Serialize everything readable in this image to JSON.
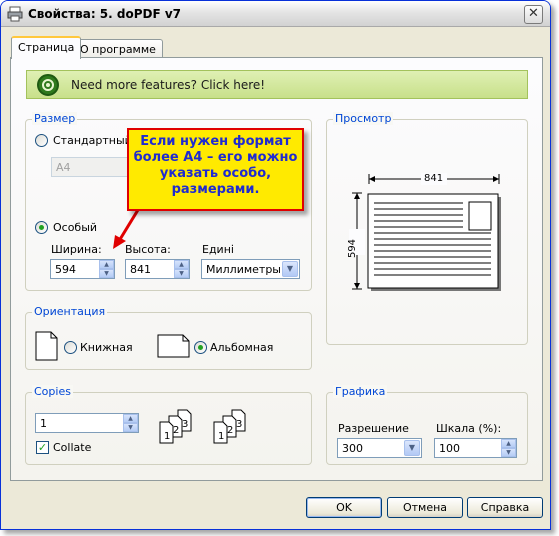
{
  "window": {
    "title": "Свойства: 5. doPDF v7",
    "close_glyph": "✕"
  },
  "tabs": [
    {
      "label": "Страница",
      "active": true
    },
    {
      "label": "О программе",
      "active": false
    }
  ],
  "banner": {
    "text": "Need more features? Click here!"
  },
  "size_group": {
    "label": "Размер",
    "standard_label": "Стандартный",
    "standard_value": "A4",
    "custom_label": "Особый",
    "width_label": "Ширина:",
    "width_value": "594",
    "height_label": "Высота:",
    "height_value": "841",
    "units_label": "Едині",
    "units_value": "Миллиметры",
    "selected": "custom"
  },
  "callout": {
    "lines": [
      "Если нужен формат",
      "более A4 – его можно",
      "указать особо,",
      "размерами."
    ],
    "colors": {
      "fill": "#ffea00",
      "border": "#e00000",
      "text": "#1f2bd1"
    }
  },
  "preview_group": {
    "label": "Просмотр",
    "width_dim": "841",
    "height_dim": "594"
  },
  "orientation_group": {
    "label": "Ориентация",
    "portrait_label": "Книжная",
    "landscape_label": "Альбомная",
    "selected": "landscape"
  },
  "copies_group": {
    "label": "Copies",
    "copies_value": "1",
    "collate_label": "Collate",
    "collate_checked": true,
    "collate_page_numbers": [
      "1",
      "2",
      "3"
    ]
  },
  "graphics_group": {
    "label": "Графика",
    "resolution_label": "Разрешение",
    "resolution_value": "300",
    "scale_label": "Шкала (%):",
    "scale_value": "100"
  },
  "buttons": {
    "ok": "OK",
    "cancel": "Отмена",
    "help": "Справка"
  },
  "colors": {
    "accent": "#0046d5",
    "dialog_bg": "#ece9d8",
    "banner_green": "#c8e08a"
  }
}
